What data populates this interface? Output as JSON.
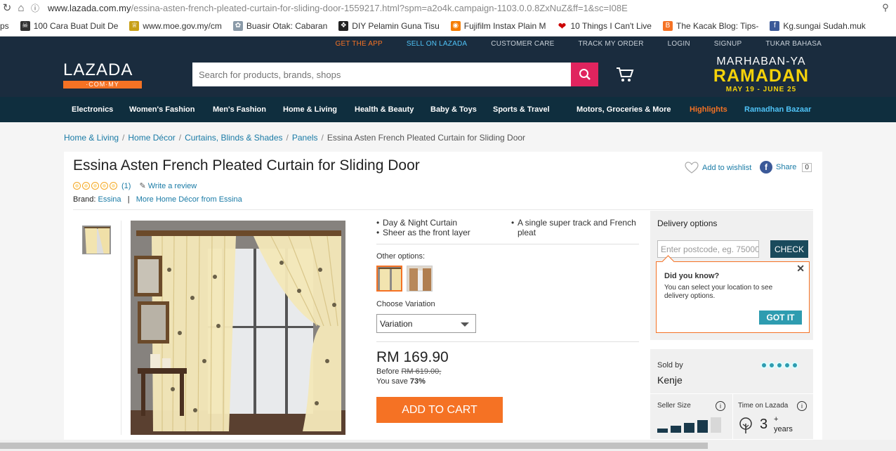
{
  "browser": {
    "url_main": "www.lazada.com.my",
    "url_path": "/essina-asten-french-pleated-curtain-for-sliding-door-1559217.html?spm=a2o4k.campaign-1103.0.0.8ZxNuZ&ff=1&sc=I08E",
    "bookmarks": [
      {
        "label": "ps",
        "icon": "apps-icon"
      },
      {
        "label": "100 Cara Buat Duit De",
        "icon": "skull-icon"
      },
      {
        "label": "www.moe.gov.my/cm",
        "icon": "crest-icon"
      },
      {
        "label": "Buasir Otak: Cabaran",
        "icon": "brain-icon"
      },
      {
        "label": "DIY Pelamin Guna Tisu",
        "icon": "bird-icon"
      },
      {
        "label": "Fujifilm Instax Plain M",
        "icon": "camera-icon"
      },
      {
        "label": "10 Things I Can't Live",
        "icon": "heart-icon"
      },
      {
        "label": "The Kacak Blog: Tips-",
        "icon": "blogger-icon"
      },
      {
        "label": "Kg.sungai Sudah.muk",
        "icon": "facebook-icon"
      }
    ]
  },
  "topbar": {
    "get_app": "GET THE APP",
    "sell": "SELL ON LAZADA",
    "care": "CUSTOMER CARE",
    "track": "TRACK MY ORDER",
    "login": "LOGIN",
    "signup": "SIGNUP",
    "lang": "TUKAR BAHASA"
  },
  "header": {
    "logo_main": "LAZADA",
    "logo_sub": "·COM·MY",
    "search_placeholder": "Search for products, brands, shops",
    "promo_l1": "MARHABAN-YA",
    "promo_l2": "RAMADAN",
    "promo_l3": "MAY 19 - JUNE 25"
  },
  "categories": [
    "Electronics",
    "Women's Fashion",
    "Men's Fashion",
    "Home & Living",
    "Health & Beauty",
    "Baby & Toys",
    "Sports & Travel",
    "Motors, Groceries & More",
    "Highlights",
    "Ramadhan Bazaar"
  ],
  "breadcrumb": [
    "Home & Living",
    "Home Décor",
    "Curtains, Blinds & Shades",
    "Panels",
    "Essina Asten French Pleated Curtain for Sliding Door"
  ],
  "product": {
    "title": "Essina Asten French Pleated Curtain for Sliding Door",
    "rating_count": "(1)",
    "write_review": "Write a review",
    "brand_label": "Brand:",
    "brand": "Essina",
    "brand_sep": "|",
    "more_from": "More Home Décor from Essina",
    "wishlist": "Add to wishlist",
    "share": "Share",
    "share_count": "0",
    "features_left": [
      "Day & Night Curtain",
      "Sheer as the front layer"
    ],
    "features_right": [
      "A single super track and French pleat"
    ],
    "other_options_label": "Other options:",
    "variation_label": "Choose Variation",
    "variation_value": "Variation",
    "price": "RM 169.90",
    "before_label": "Before",
    "before_price": "RM 619.00,",
    "save_label": "You save",
    "save_pct": "73%",
    "add_to_cart": "ADD TO CART"
  },
  "delivery": {
    "title": "Delivery options",
    "postcode_placeholder": "Enter postcode, eg. 75000",
    "check": "CHECK",
    "tip_title": "Did you know?",
    "tip_text": "You can select your location to see delivery options.",
    "got_it": "GOT IT"
  },
  "seller": {
    "sold_by": "Sold by",
    "name": "Kenje",
    "size_label": "Seller Size",
    "size_level": 4,
    "size_max": 5,
    "time_label": "Time on Lazada",
    "years_value": "3",
    "years_plus": "+",
    "years_unit": "years"
  },
  "colors": {
    "navy": "#1a2c3e",
    "accent": "#f57224",
    "search_btn": "#e0245e",
    "link": "#1a7ba6",
    "teal": "#2e9cb0"
  }
}
